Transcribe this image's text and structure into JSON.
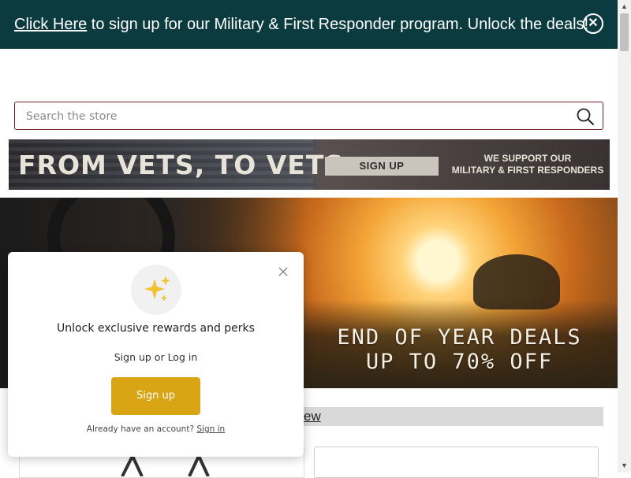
{
  "announcement": {
    "link_text": "Click Here",
    "text": " to sign up for our Military & First Responder program. Unlock the deals!"
  },
  "search": {
    "placeholder": "Search the store"
  },
  "vets_banner": {
    "title": "FROM VETS, TO VETS",
    "button": "SIGN UP",
    "support_line1": "WE SUPPORT OUR",
    "support_line2": "MILITARY & FIRST RESPONDERS"
  },
  "hero": {
    "line1": "END OF YEAR DEALS",
    "line2": "UP TO 70% OFF"
  },
  "section": {
    "tab_partial": "ew"
  },
  "rewards_popup": {
    "title": "Unlock exclusive rewards and perks",
    "subtitle": "Sign up or Log in",
    "button": "Sign up",
    "footer_text": "Already have an account?",
    "footer_link": "Sign in",
    "accent_color": "#d9a515"
  },
  "colors": {
    "announcement_bg": "#0b3b3f",
    "search_border": "#7a1f1f"
  },
  "icons": [
    "close-icon",
    "search-icon",
    "sparkles-icon",
    "scroll-up-icon",
    "scroll-down-icon"
  ]
}
